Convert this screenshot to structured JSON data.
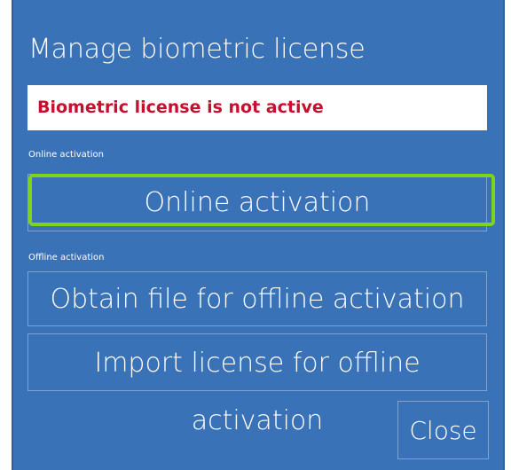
{
  "dialog": {
    "title": "Manage biometric license",
    "status": "Biometric license is not active",
    "online_section_label": "Online activation",
    "online_button_label": "Online activation",
    "offline_section_label": "Offline activation",
    "obtain_file_button_label": "Obtain file for offline activation",
    "import_license_button_label": "Import license for offline activation",
    "close_button_label": "Close"
  },
  "colors": {
    "background": "#3a72b8",
    "status_text": "#c8102e",
    "highlight": "#7fd41a"
  }
}
